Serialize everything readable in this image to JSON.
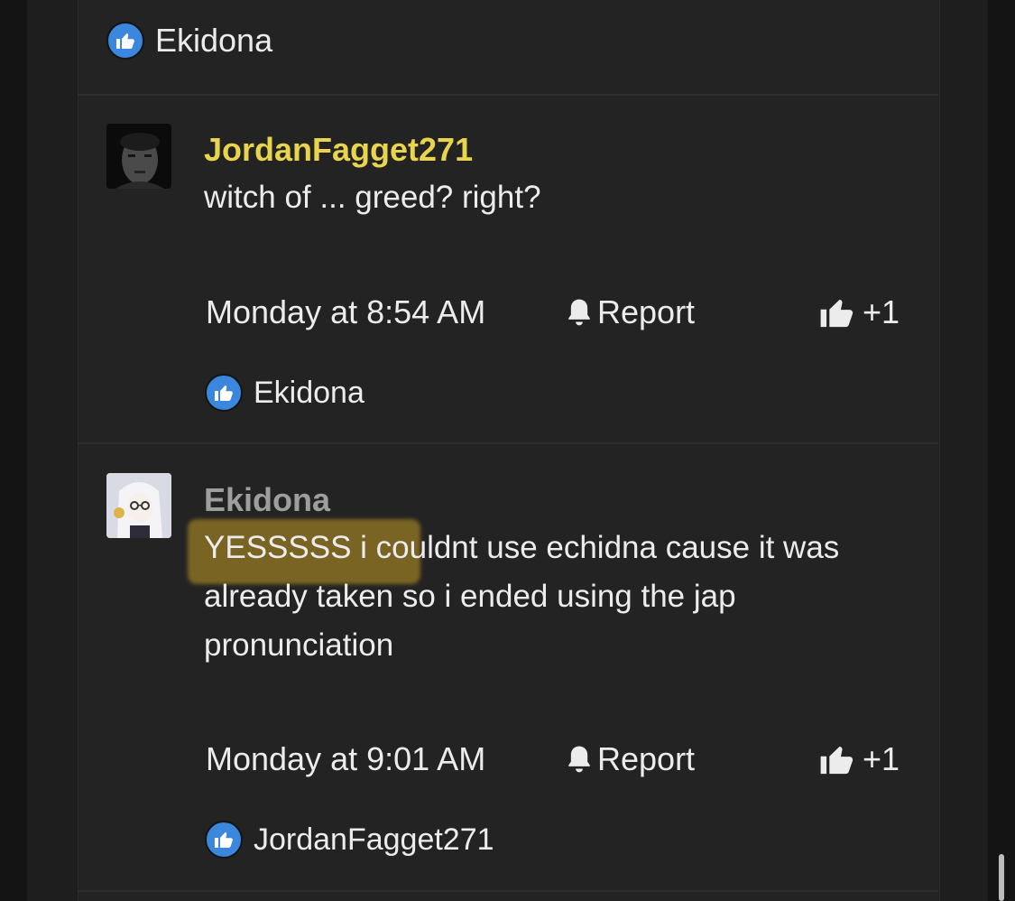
{
  "top_reaction": {
    "name": "Ekidona"
  },
  "posts": [
    {
      "username": "JordanFagget271",
      "username_color": "#e8d44d",
      "body": "witch of ... greed? right?",
      "timestamp": "Monday at 8:54 AM",
      "report_label": "Report",
      "like_count": "+1",
      "reactions": [
        "Ekidona"
      ]
    },
    {
      "username": "Ekidona",
      "username_color": "#9e9e9e",
      "body": "YESSSSS i couldnt use echidna cause it was already taken so i ended using the jap pronunciation",
      "timestamp": "Monday at 9:01 AM",
      "report_label": "Report",
      "like_count": "+1",
      "reactions": [
        "JordanFagget271"
      ]
    }
  ],
  "colors": {
    "background": "#232323",
    "accent_like": "#3a87dd",
    "highlight": "#c09a24"
  }
}
